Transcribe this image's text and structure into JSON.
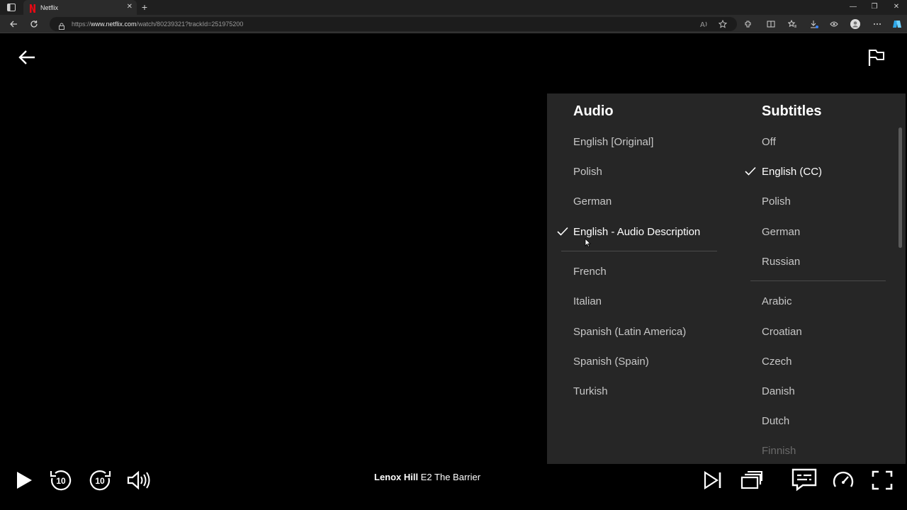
{
  "browser": {
    "tab_title": "Netflix",
    "tab_close": "✕",
    "newtab": "+",
    "url_prefix": "https://",
    "url_host": "www.netflix.com",
    "url_path": "/watch/80239321?trackId=251975200",
    "win_minimize": "—",
    "win_restore": "❐",
    "win_close": "✕"
  },
  "audio": {
    "title": "Audio",
    "options": [
      "English [Original]",
      "Polish",
      "German",
      "English - Audio Description",
      "French",
      "Italian",
      "Spanish (Latin America)",
      "Spanish (Spain)",
      "Turkish"
    ],
    "selected": "English - Audio Description"
  },
  "subtitles": {
    "title": "Subtitles",
    "options": [
      "Off",
      "English (CC)",
      "Polish",
      "German",
      "Russian",
      "Arabic",
      "Croatian",
      "Czech",
      "Danish",
      "Dutch",
      "Finnish"
    ],
    "selected": "English (CC)"
  },
  "now_playing": {
    "show": "Lenox Hill",
    "episode": "E2",
    "episode_title": "The Barrier"
  },
  "colors": {
    "panel_bg": "#262626",
    "accent_red": "#e50914"
  }
}
